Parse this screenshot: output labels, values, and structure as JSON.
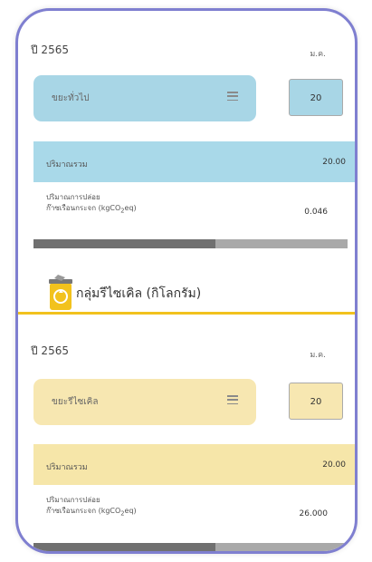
{
  "section1": {
    "year": "ปี 2565",
    "month": "ม.ค.",
    "category": "ขยะทั่วไป",
    "quantity": "20",
    "total_label": "ปริมาณรวม",
    "total_value": "20.00",
    "emission_label_line1": "ปริมาณการปล่อย",
    "emission_label_line2": "ก๊าซเรือนกระจก (kgCO",
    "emission_label_sub": "2",
    "emission_label_end": "eq)",
    "emission_value": "0.046",
    "scroll_progress": 0.58
  },
  "recycle": {
    "title": "กลุ่มรีไซเคิล (กิโลกรัม)",
    "year": "ปี 2565",
    "month": "ม.ค.",
    "category": "ขยะรีไซเคิล",
    "quantity": "20",
    "total_label": "ปริมาณรวม",
    "total_value": "20.00",
    "emission_label_line1": "ปริมาณการปล่อย",
    "emission_label_line2": "ก๊าซเรือนกระจก (kgCO",
    "emission_label_sub": "2",
    "emission_label_end": "eq)",
    "emission_value": "26.000",
    "scroll_progress": 0.58
  },
  "colors": {
    "frame": "#7f7fd0",
    "general_light": "#a8d6e6",
    "general_band": "#a9d9e9",
    "recycle_light": "#f7e7b1",
    "recycle_band": "#f6e6a9",
    "divider": "#f2c21d"
  },
  "icons": {
    "menu": "menu-icon",
    "bin": "recycle-bin-icon"
  }
}
